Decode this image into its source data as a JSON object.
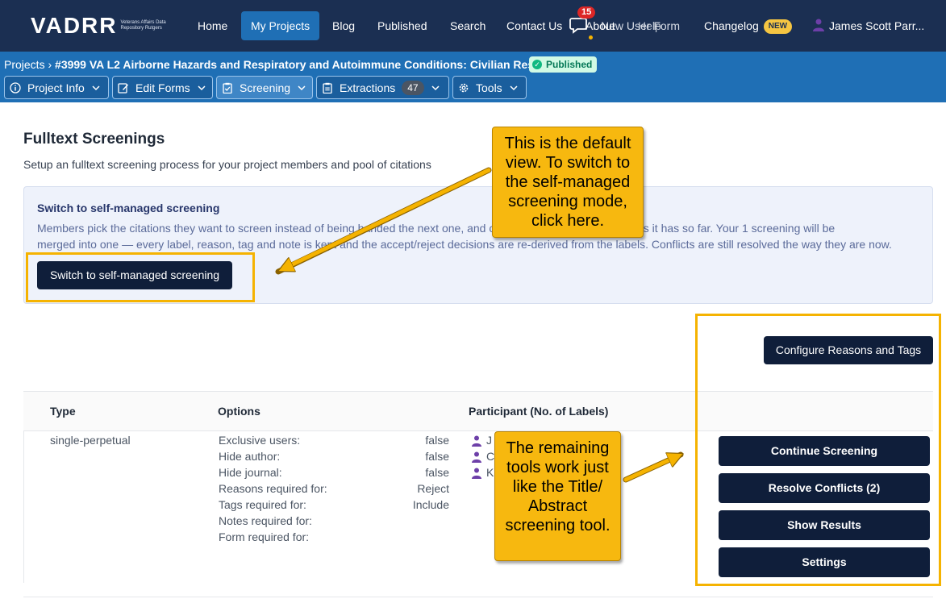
{
  "brand": {
    "name": "VADRR",
    "subtitle": "Veterans Affairs Data Repository Rutgers"
  },
  "nav": {
    "items": [
      "Home",
      "My Projects",
      "Blog",
      "Published",
      "Search",
      "Contact Us"
    ],
    "active": "My Projects",
    "chat_count": "15",
    "about_label": "About",
    "overlap_label": "New User Form",
    "help_label": "Help",
    "changelog_label": "Changelog",
    "changelog_badge": "NEW",
    "user_name": "James Scott Parr..."
  },
  "project": {
    "breadcrumb_root": "Projects",
    "title": "#3999 VA L2 Airborne Hazards and Respiratory and Autoimmune Conditions: Civilian Rese...",
    "status": "Published",
    "tabs": [
      {
        "label": "Project Info",
        "icon": "info-icon"
      },
      {
        "label": "Edit Forms",
        "icon": "edit-icon"
      },
      {
        "label": "Screening",
        "icon": "clipboard-check-icon",
        "active": true
      },
      {
        "label": "Extractions",
        "icon": "clipboard-icon",
        "count": "47"
      },
      {
        "label": "Tools",
        "icon": "gear-icon"
      }
    ]
  },
  "main": {
    "title": "Fulltext Screenings",
    "description": "Setup an fulltext screening process for your project members and pool of citations",
    "info": {
      "title": "Switch to self-managed screening",
      "line1": "Members pick the citations they want to screen instead of being handed the next one, and citations are kept with the labels it has so far. Your 1 screening will be",
      "line2": "merged into one — every label, reason, tag and note is kept and the accept/reject decisions are re-derived from the labels. Conflicts are still resolved the way they are now.",
      "button": "Switch to self-managed screening"
    },
    "configure_button": "Configure Reasons and Tags",
    "table": {
      "headers": [
        "Type",
        "Options",
        "Participant (No. of Labels)"
      ],
      "type": "single-perpetual",
      "options": [
        {
          "label": "Exclusive users:",
          "value": "false"
        },
        {
          "label": "Hide author:",
          "value": "false"
        },
        {
          "label": "Hide journal:",
          "value": "false"
        },
        {
          "label": "Reasons required for:",
          "value": "Reject"
        },
        {
          "label": "Tags required for:",
          "value": "Include"
        },
        {
          "label": "Notes required for:",
          "value": ""
        },
        {
          "label": "Form required for:",
          "value": ""
        }
      ],
      "participants": [
        "J",
        "C",
        "K"
      ]
    },
    "actions": [
      "Continue Screening",
      "Resolve Conflicts (2)",
      "Show Results",
      "Settings"
    ]
  },
  "callouts": {
    "top": "This is the default view. To switch to the self-managed screening mode, click here.",
    "bottom": "The remaining tools work just like the Title/ Abstract screening tool."
  },
  "colors": {
    "navbar": "#1b2f52",
    "subbar": "#1f6fb5",
    "button_dark": "#0f1e3a",
    "callout": "#f7b80f",
    "highlight": "#f5b301",
    "published": "#10b981"
  }
}
